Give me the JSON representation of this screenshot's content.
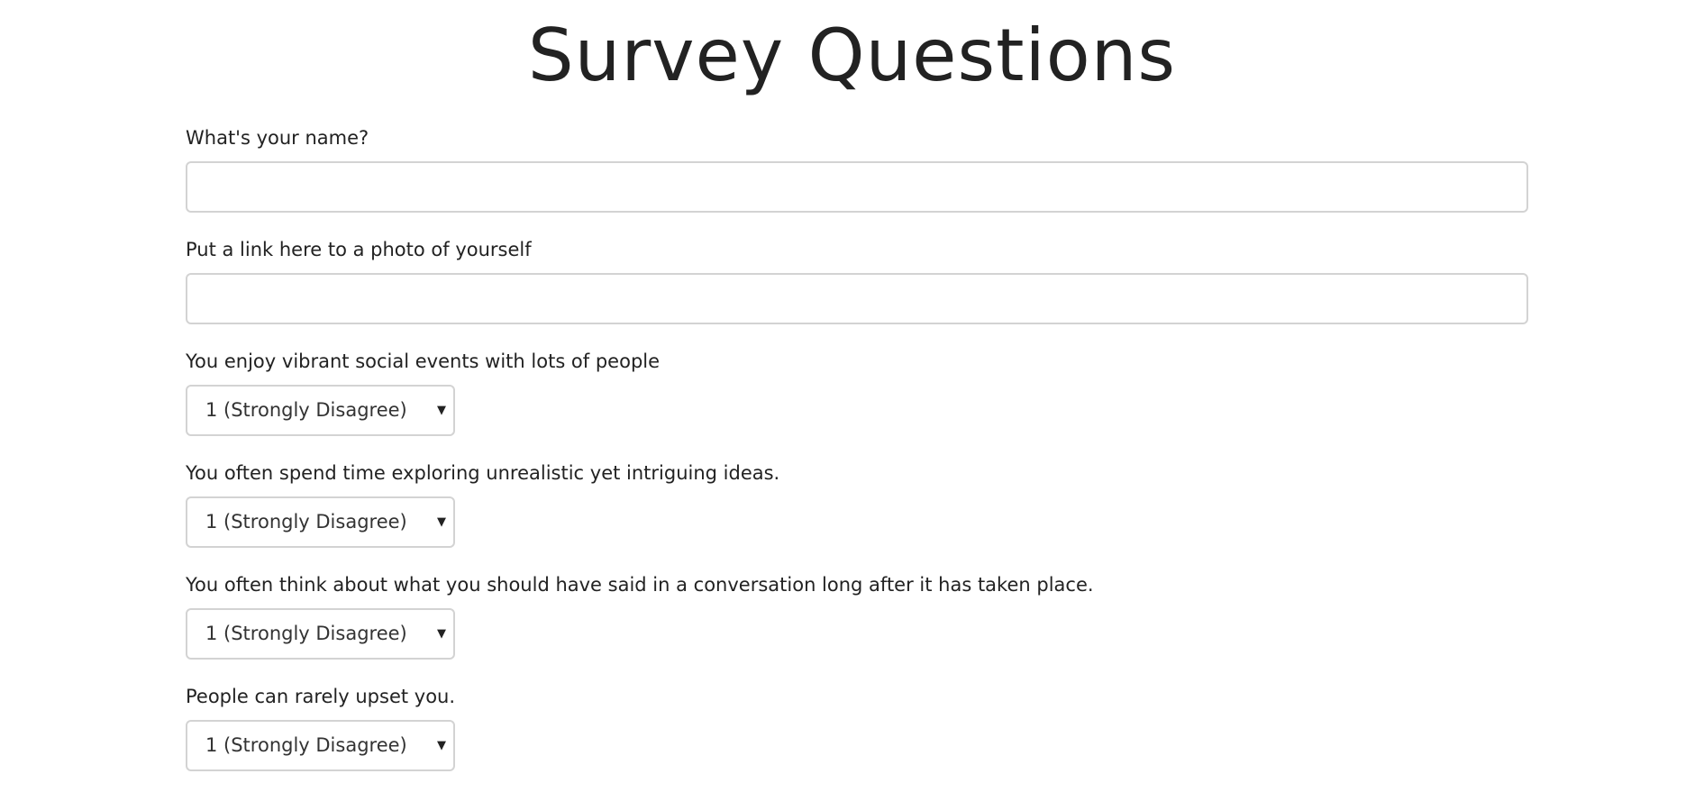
{
  "page": {
    "title": "Survey Questions"
  },
  "form": {
    "name": {
      "label": "What's your name?",
      "value": "",
      "placeholder": ""
    },
    "photo": {
      "label": "Put a link here to a photo of yourself",
      "value": "",
      "placeholder": ""
    },
    "questions": [
      {
        "label": "You enjoy vibrant social events with lots of people",
        "selected": "1 (Strongly Disagree)",
        "arrow_icon": "caret-down-icon"
      },
      {
        "label": "You often spend time exploring unrealistic yet intriguing ideas.",
        "selected": "1 (Strongly Disagree)",
        "arrow_icon": "caret-down-icon"
      },
      {
        "label": "You often think about what you should have said in a conversation long after it has taken place.",
        "selected": "1 (Strongly Disagree)",
        "arrow_icon": "caret-down-icon"
      },
      {
        "label": "People can rarely upset you.",
        "selected": "1 (Strongly Disagree)",
        "arrow_icon": "caret-down-icon"
      }
    ]
  },
  "colors": {
    "text": "#222222",
    "input_border": "#d3d3d3",
    "background": "#ffffff"
  }
}
